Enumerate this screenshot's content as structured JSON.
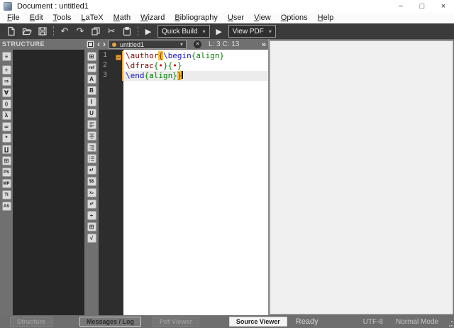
{
  "window": {
    "title": "Document : untitled1",
    "controls": {
      "minimize": "−",
      "maximize": "□",
      "close": "×"
    }
  },
  "menu_bar": {
    "items": [
      "File",
      "Edit",
      "Tools",
      "LaTeX",
      "Math",
      "Wizard",
      "Bibliography",
      "User",
      "View",
      "Options",
      "Help"
    ]
  },
  "toolbar": {
    "buttons": [
      {
        "type": "icon",
        "name": "new-document-icon",
        "glyph": "svg:new"
      },
      {
        "type": "icon",
        "name": "open-file-icon",
        "glyph": "svg:open"
      },
      {
        "type": "icon",
        "name": "save-icon",
        "glyph": "svg:save"
      },
      {
        "type": "sep"
      },
      {
        "type": "icon",
        "name": "undo-icon",
        "glyph": "↶"
      },
      {
        "type": "icon",
        "name": "redo-icon",
        "glyph": "↷"
      },
      {
        "type": "icon",
        "name": "copy-icon",
        "glyph": "svg:copy"
      },
      {
        "type": "icon",
        "name": "cut-icon",
        "glyph": "✂"
      },
      {
        "type": "icon",
        "name": "paste-icon",
        "glyph": "svg:paste"
      },
      {
        "type": "sep"
      },
      {
        "type": "play",
        "name": "run-quick-build-icon",
        "glyph": "▶"
      },
      {
        "type": "combo",
        "name": "quick-build-select",
        "label": "Quick Build",
        "arrow": "▾"
      },
      {
        "type": "play",
        "name": "run-view-pdf-icon",
        "glyph": "▶"
      },
      {
        "type": "combo",
        "name": "view-pdf-select",
        "label": "View PDF",
        "arrow": "▾"
      }
    ]
  },
  "structure_panel": {
    "header": "STRUCTURE"
  },
  "side_tabs": [
    {
      "name": "structure-tab",
      "glyph": "≡"
    },
    {
      "name": "relation-symbols-tab",
      "glyph": "÷"
    },
    {
      "name": "arrow-symbols-tab",
      "glyph": "⇒"
    },
    {
      "name": "misc-symbols-tab",
      "glyph": "∀"
    },
    {
      "name": "delimiters-tab",
      "glyph": "()"
    },
    {
      "name": "greek-letters-tab",
      "glyph": "λ"
    },
    {
      "name": "most-used-symbols-tab",
      "glyph": "∞"
    },
    {
      "name": "misc-math-tab",
      "glyph": "*"
    },
    {
      "name": "big-operators-tab",
      "glyph": "∐"
    },
    {
      "name": "user-tags-tab",
      "glyph": "⊞"
    },
    {
      "name": "pstricks-tab",
      "glyph": "PS"
    },
    {
      "name": "metapost-tab",
      "glyph": "MP"
    },
    {
      "name": "tikz-tab",
      "glyph": "TI"
    },
    {
      "name": "asymptote-tab",
      "glyph": "AS"
    }
  ],
  "edit_toolbar": [
    {
      "name": "new-block-icon",
      "glyph": "⊞"
    },
    {
      "name": "label-ref-icon",
      "glyph": "ref"
    },
    {
      "name": "font-icon",
      "glyph": "A"
    },
    {
      "name": "bold-icon",
      "glyph": "B"
    },
    {
      "name": "italic-icon",
      "glyph": "I"
    },
    {
      "name": "underline-icon",
      "glyph": "U"
    },
    {
      "name": "align-left-icon",
      "glyph": "svg:align-left"
    },
    {
      "name": "align-center-icon",
      "glyph": "svg:align-center"
    },
    {
      "name": "align-right-icon",
      "glyph": "svg:align-right"
    },
    {
      "name": "itemize-icon",
      "glyph": "svg:list"
    },
    {
      "name": "newline-icon",
      "glyph": "↵"
    },
    {
      "name": "math-mode-icon",
      "glyph": "$$"
    },
    {
      "name": "subscript-icon",
      "glyph": "x₂"
    },
    {
      "name": "superscript-icon",
      "glyph": "x²"
    },
    {
      "name": "fraction-icon",
      "glyph": "÷"
    },
    {
      "name": "matrix-icon",
      "glyph": "⊞"
    },
    {
      "name": "sqrt-icon",
      "glyph": "√"
    }
  ],
  "editor": {
    "header": {
      "prev": "‹",
      "next": "›",
      "tab": "untitled1",
      "combo_arrow": "▾",
      "close": "✕",
      "position": "L: 3 C: 13",
      "overflow": "»"
    },
    "lines": [
      {
        "number": "1",
        "fold": true,
        "tokens": [
          {
            "text": "\\author",
            "cls": "cmd"
          },
          {
            "text": "{",
            "cls": "match"
          },
          {
            "text": "\\begin",
            "cls": "kw"
          },
          {
            "text": "{align}",
            "cls": "env"
          }
        ]
      },
      {
        "number": "2",
        "tokens": [
          {
            "text": "\\dfrac",
            "cls": "cmd"
          },
          {
            "text": "{",
            "cls": "env"
          },
          {
            "text": "•",
            "cls": "bullet"
          },
          {
            "text": "}",
            "cls": "env"
          },
          {
            "text": "{",
            "cls": "env"
          },
          {
            "text": "•",
            "cls": "bullet"
          },
          {
            "text": "}",
            "cls": "env"
          }
        ]
      },
      {
        "number": "3",
        "current": true,
        "cursor": true,
        "tokens": [
          {
            "text": "\\end",
            "cls": "kw"
          },
          {
            "text": "{align}",
            "cls": "env"
          },
          {
            "text": "}",
            "cls": "match"
          }
        ]
      }
    ]
  },
  "status_bar": {
    "tabs": [
      {
        "label": "Structure",
        "state": "dim"
      },
      {
        "label": "Messages / Log",
        "state": "outlined"
      },
      {
        "label": "Pdf Viewer",
        "state": "dim"
      },
      {
        "label": "Source Viewer",
        "state": "active"
      }
    ],
    "ready": "Ready",
    "encoding": "UTF-8",
    "mode": "Normal Mode"
  },
  "colors": {
    "cmd": "#800000",
    "kw": "#1414c8",
    "env": "#008000",
    "bullet": "#cc1111",
    "match_text": "#7a3300",
    "match_bg": "#f9be3c",
    "modified_dot": "#e8a33d",
    "fold_marker": "#e8a33d"
  }
}
